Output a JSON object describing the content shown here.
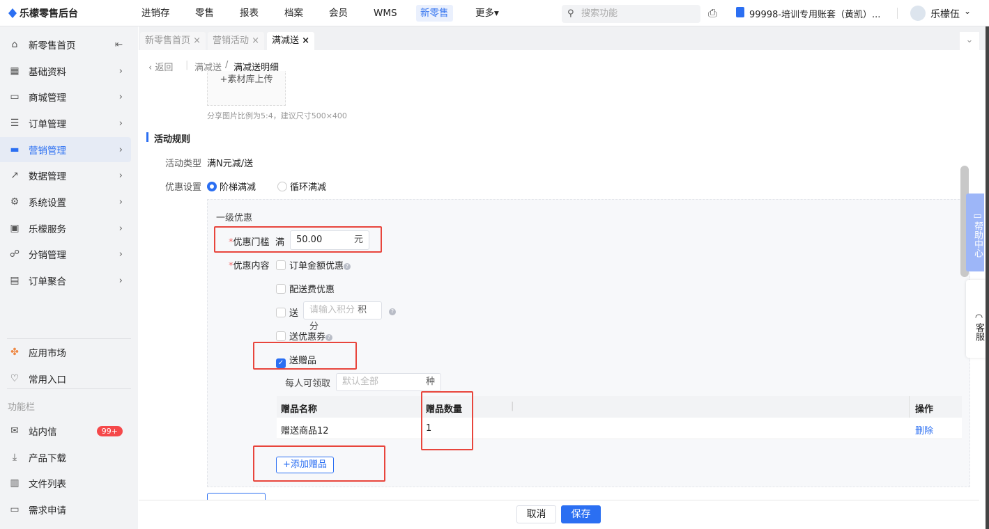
{
  "app": {
    "name": "乐檬零售后台"
  },
  "topnav": [
    "进销存",
    "零售",
    "报表",
    "档案",
    "会员",
    "WMS",
    "新零售",
    "更多▾"
  ],
  "search": {
    "placeholder": "搜索功能"
  },
  "account": "99998-培训专用账套（黄凯）...",
  "user": "乐檬伍",
  "sidebar": {
    "items": [
      {
        "label": "新零售首页"
      },
      {
        "label": "基础资料"
      },
      {
        "label": "商城管理"
      },
      {
        "label": "订单管理"
      },
      {
        "label": "营销管理"
      },
      {
        "label": "数据管理"
      },
      {
        "label": "系统设置"
      },
      {
        "label": "乐檬服务"
      },
      {
        "label": "分销管理"
      },
      {
        "label": "订单聚合"
      }
    ],
    "bottom": [
      {
        "label": "应用市场"
      },
      {
        "label": "常用入口"
      }
    ],
    "section": "功能栏",
    "tools": [
      {
        "label": "站内信",
        "badge": "99+"
      },
      {
        "label": "产品下载"
      },
      {
        "label": "文件列表"
      },
      {
        "label": "需求申请"
      }
    ]
  },
  "tabs": [
    "新零售首页",
    "营销活动",
    "满减送"
  ],
  "breadcrumb": {
    "back": "返回",
    "parent": "满减送",
    "current": "满减送明细"
  },
  "upload": {
    "label": "+素材库上传",
    "hint": "分享图片比例为5:4，建议尺寸500×400"
  },
  "rules": {
    "title": "活动规则",
    "type_label": "活动类型",
    "type_value": "满N元减/送",
    "setting_label": "优惠设置",
    "options": [
      "阶梯满减",
      "循环满减"
    ],
    "level": "一级优惠",
    "threshold_label": "优惠门槛",
    "threshold_prefix": "满",
    "threshold_value": "50.00",
    "threshold_unit": "元",
    "content_label": "优惠内容",
    "opt_order": "订单金额优惠",
    "opt_delivery": "配送费优惠",
    "opt_points": "送",
    "points_placeholder": "请输入积分",
    "points_unit": "积分",
    "opt_coupon": "送优惠券",
    "opt_gift": "送赠品",
    "per_label": "每人可领取",
    "per_placeholder": "默认全部",
    "per_unit": "种",
    "table": {
      "headers": [
        "赠品名称",
        "赠品数量",
        "操作"
      ],
      "rows": [
        {
          "name": "赠送商品12",
          "qty": "1",
          "action": "删除"
        }
      ]
    },
    "add_gift": "+添加赠品"
  },
  "float": {
    "help": "帮助中心",
    "service": "客服"
  },
  "footer": {
    "cancel": "取消",
    "save": "保存"
  }
}
